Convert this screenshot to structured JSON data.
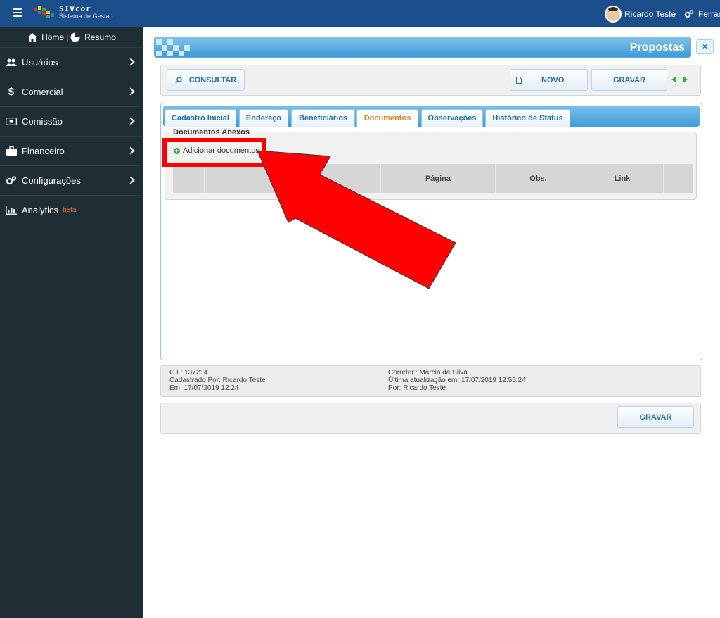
{
  "app": {
    "name": "SIVcor",
    "subtitle": "Sistema de Gestao"
  },
  "header": {
    "user_name": "Ricardo Teste",
    "tools_label": "Ferramentas"
  },
  "sidebar": {
    "home_label": "Home",
    "home_separator": "|",
    "summary_label": "Resumo",
    "items": [
      {
        "label": "Usuários",
        "icon": "users-icon"
      },
      {
        "label": "Comercial",
        "icon": "dollar-icon"
      },
      {
        "label": "Comissão",
        "icon": "money-icon"
      },
      {
        "label": "Financeiro",
        "icon": "briefcase-icon"
      },
      {
        "label": "Configurações",
        "icon": "gears-icon"
      },
      {
        "label": "Analytics",
        "icon": "bar-chart-icon",
        "badge": "beta"
      }
    ]
  },
  "page": {
    "title": "Propostas",
    "close_label": "×"
  },
  "toolbar": {
    "consultar_label": "CONSULTAR",
    "novo_label": "NOVO",
    "gravar_label": "GRAVAR"
  },
  "tabs": [
    {
      "label": "Cadastro Inicial"
    },
    {
      "label": "Endereço"
    },
    {
      "label": "Beneficiários"
    },
    {
      "label": "Documentos"
    },
    {
      "label": "Observações"
    },
    {
      "label": "Histórico de Status"
    }
  ],
  "documents": {
    "legend": "Documentos Anexos",
    "add_label": "Adicionar documentos",
    "columns": [
      "",
      "",
      "Página",
      "Obs.",
      "Link",
      ""
    ]
  },
  "info": {
    "ci": "C.I.: 137214",
    "created_by": "Cadastrado Por: Ricardo Teste",
    "created_at": "Em: 17/07/2019 12:24",
    "broker": "Corretor.: Marcio da Silva",
    "updated_at": "Última atualização em: 17/07/2019 12:55:24",
    "updated_by": "Por: Ricardo Teste"
  },
  "footer": {
    "gravar_label": "GRAVAR"
  },
  "colors": {
    "topbar": "#1b4f8c",
    "sidebar": "#1f2d35",
    "accent_blue": "#3d9ad7",
    "active_tab": "#e87c1e",
    "annotation_red": "#ff0000"
  }
}
